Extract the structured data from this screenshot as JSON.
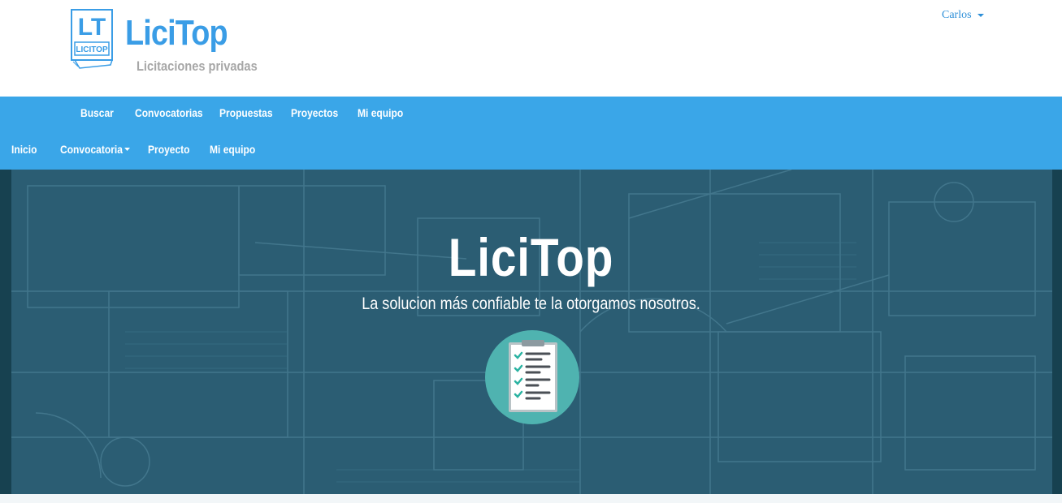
{
  "header": {
    "logo_letters": "LT",
    "logo_caption": "LICITOP",
    "brand_title": "LiciTop",
    "brand_subtitle": "Licitaciones privadas",
    "user_name": "Carlos"
  },
  "nav": {
    "top_items": [
      "Buscar",
      "Convocatorias",
      "Propuestas",
      "Proyectos",
      "Mi equipo"
    ],
    "bottom_items": [
      "Inicio",
      "Convocatoria",
      "Proyecto",
      "Mi equipo"
    ]
  },
  "hero": {
    "title": "LiciTop",
    "tagline": "La solucion más confiable te la otorgamos nosotros."
  },
  "colors": {
    "brand_blue": "#3a9de6",
    "navbar": "#3aa6e8",
    "hero_overlay": "#2b5d73",
    "icon_circle": "#4fb3b0"
  },
  "icons": {
    "logo": "licitop-logo",
    "hero": "checklist-clipboard-icon"
  }
}
